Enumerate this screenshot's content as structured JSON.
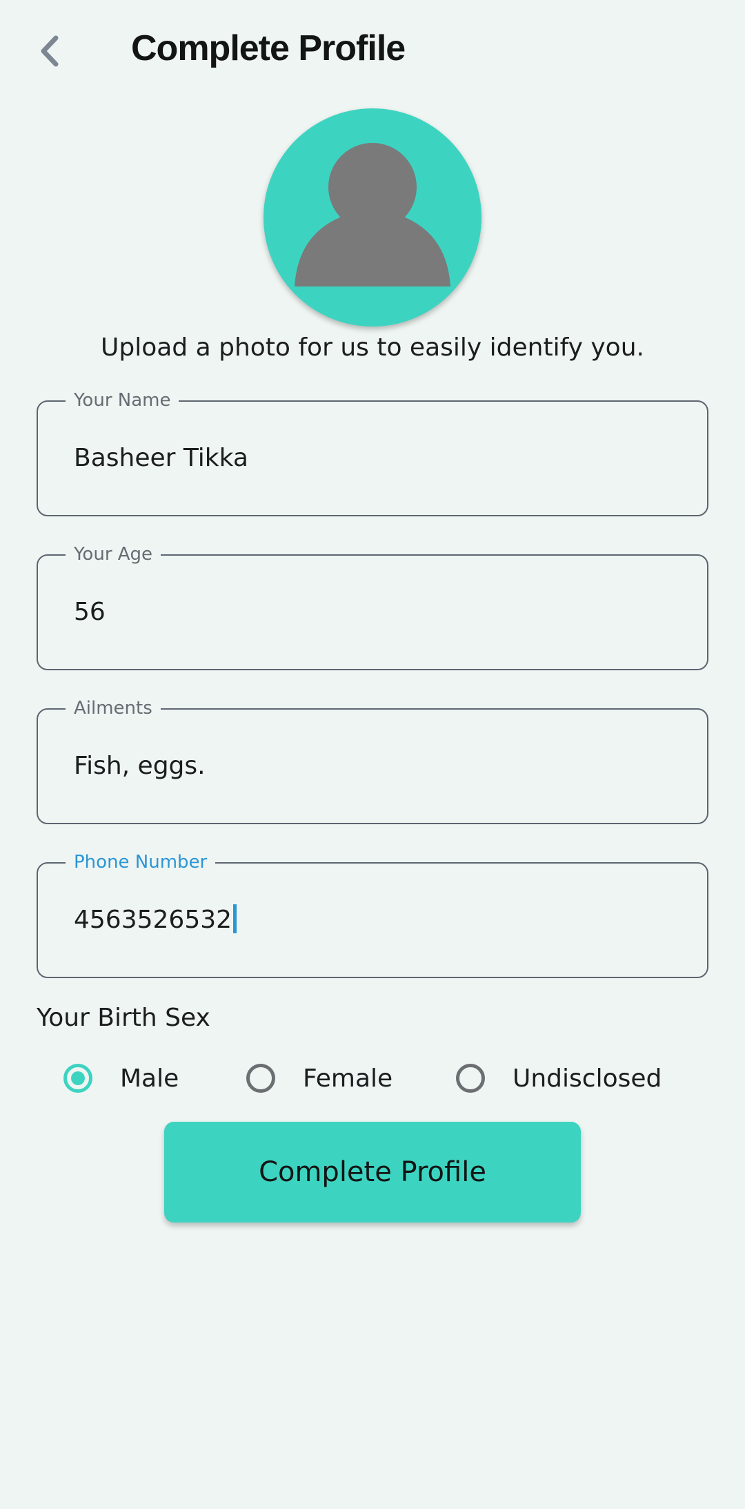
{
  "header": {
    "title": "Complete Profile",
    "back_icon": "chevron-left-icon"
  },
  "avatar": {
    "icon": "person-silhouette-icon",
    "caption": "Upload a photo for us to easily identify you."
  },
  "fields": [
    {
      "label": "Your Name",
      "value": "Basheer Tikka",
      "focused": false
    },
    {
      "label": "Your Age",
      "value": "56",
      "focused": false
    },
    {
      "label": "Ailments",
      "value": "Fish, eggs.",
      "focused": false
    },
    {
      "label": "Phone Number",
      "value": "4563526532",
      "focused": true
    }
  ],
  "birth_sex": {
    "label": "Your Birth Sex",
    "options": [
      "Male",
      "Female",
      "Undisclosed"
    ],
    "selected": "Male"
  },
  "submit": {
    "label": "Complete Profile"
  },
  "colors": {
    "accent": "#3dd3c1",
    "focus": "#2b96d5",
    "background": "#eff5f2",
    "avatar_figure": "#7a7a7a"
  }
}
